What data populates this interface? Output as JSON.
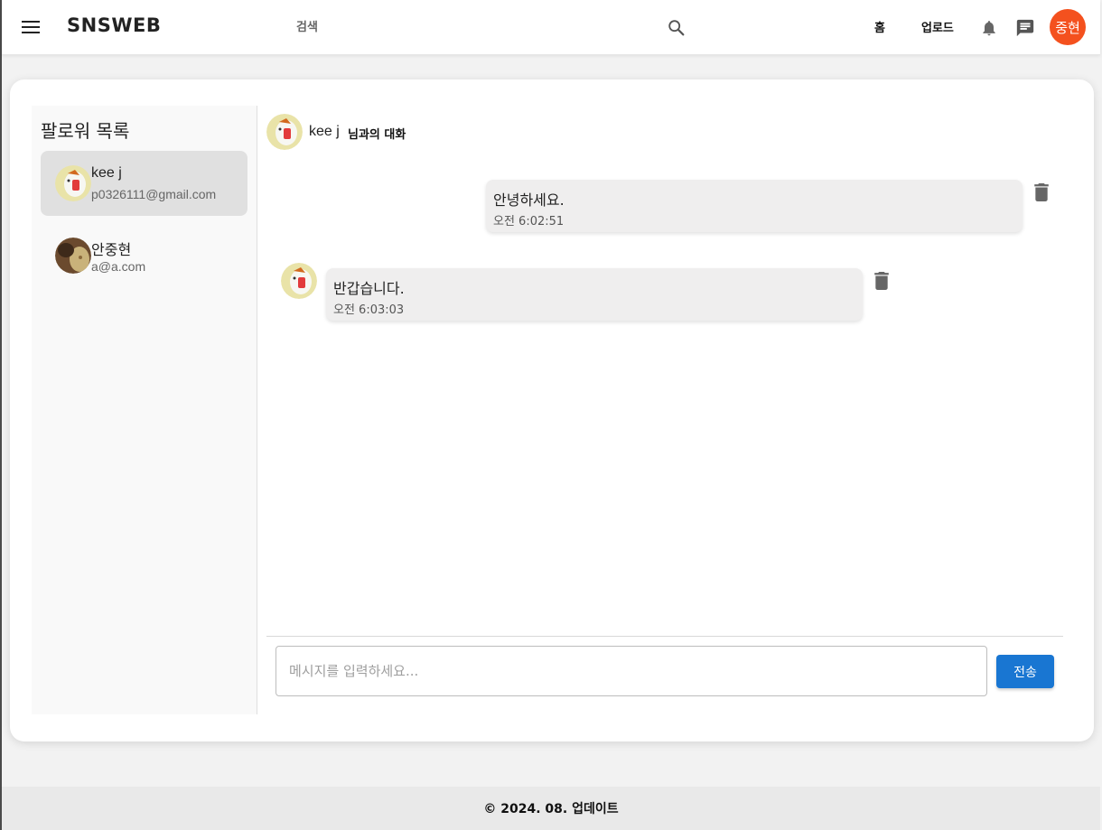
{
  "header": {
    "brand": "SNSWEB",
    "search_placeholder": "검색",
    "nav_home": "홈",
    "nav_upload": "업로드",
    "user_avatar_text": "중현",
    "user_avatar_color": "#f4511e"
  },
  "sidebar": {
    "title": "팔로워 목록",
    "followers": [
      {
        "name": "kee j",
        "email": "p0326111@gmail.com",
        "active": true
      },
      {
        "name": "안중현",
        "email": "a@a.com",
        "active": false
      }
    ]
  },
  "chat": {
    "partner_name": "kee j",
    "title_suffix": "님과의 대화",
    "messages": [
      {
        "text": "안녕하세요.",
        "time": "오전 6:02:51",
        "mine": true
      },
      {
        "text": "반갑습니다.",
        "time": "오전 6:03:03",
        "mine": false
      }
    ],
    "input_placeholder": "메시지를 입력하세요...",
    "send_label": "전송",
    "accent_color": "#1976d2"
  },
  "footer": {
    "text": "© 2024. 08. 업데이트"
  }
}
